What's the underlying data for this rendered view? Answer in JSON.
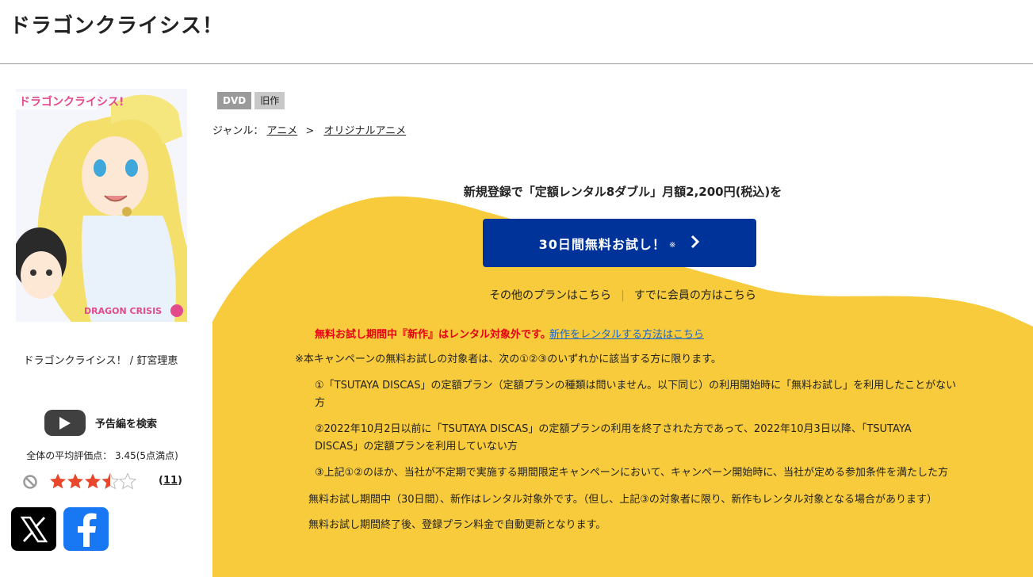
{
  "page": {
    "title": "ドラゴンクライシス！"
  },
  "product": {
    "cover_text": "DRAGON CRISIS",
    "cover_logo": "ドラゴンクライシス!",
    "work_title": "ドラゴンクライシス！ / 釘宮理恵",
    "badges": [
      "DVD",
      "旧作"
    ],
    "genre_label": "ジャンル：",
    "genre_primary": "アニメ",
    "genre_separator": ">",
    "genre_secondary": "オリジナルアニメ"
  },
  "trailer": {
    "label": "予告編を検索",
    "icon": "play-icon"
  },
  "rating": {
    "average_text": "全体の平均評価点： 3.45(5点満点)",
    "average": 3.45,
    "max": 5,
    "review_count": "11",
    "star_color": "#e8472c"
  },
  "share": {
    "x_icon": "x-logo-icon",
    "facebook_icon": "facebook-icon"
  },
  "promo": {
    "lead": "新規登録で「定額レンタル8ダブル」月額2,200円(税込)を",
    "cta_label": "30日間無料お試し！",
    "cta_note": "※",
    "other_plans": "その他のプランはこちら",
    "separator": "|",
    "members": "すでに会員の方はこちら",
    "notice_red": "無料お試し期間中『新作』はレンタル対象外です。",
    "notice_link": "新作をレンタルする方法はこちら",
    "conditions_intro": "※本キャンペーンの無料お試しの対象者は、次の①②③のいずれかに該当する方に限ります。",
    "condition1_line1": "①「TSUTAYA DISCAS」の定額プラン（定額プランの種類は問いません。以下同じ）の利用開始時に「無料お試し」を利用したことがない",
    "condition1_line2": "方",
    "condition2_line1": "②2022年10月2日以前に「TSUTAYA DISCAS」の定額プランの利用を終了された方であって、2022年10月3日以降、「TSUTAYA",
    "condition2_line2": "DISCAS」の定額プランを利用していない方",
    "condition3": "③上記①②のほか、当社が不定期で実施する期間限定キャンペーンにおいて、キャンペーン開始時に、当社が定める参加条件を満たした方",
    "trial_note": "無料お試し期間中（30日間）、新作はレンタル対象外です。（但し、上記③の対象者に限り、新作もレンタル対象となる場合があります）",
    "renewal_note": "無料お試し期間終了後、登録プラン料金で自動更新となります。"
  },
  "colors": {
    "cta_blue": "#003399",
    "promo_yellow": "#f7cb3b",
    "notice_red": "#e60012",
    "link_blue": "#1a66cc",
    "facebook_blue": "#1877f2"
  }
}
